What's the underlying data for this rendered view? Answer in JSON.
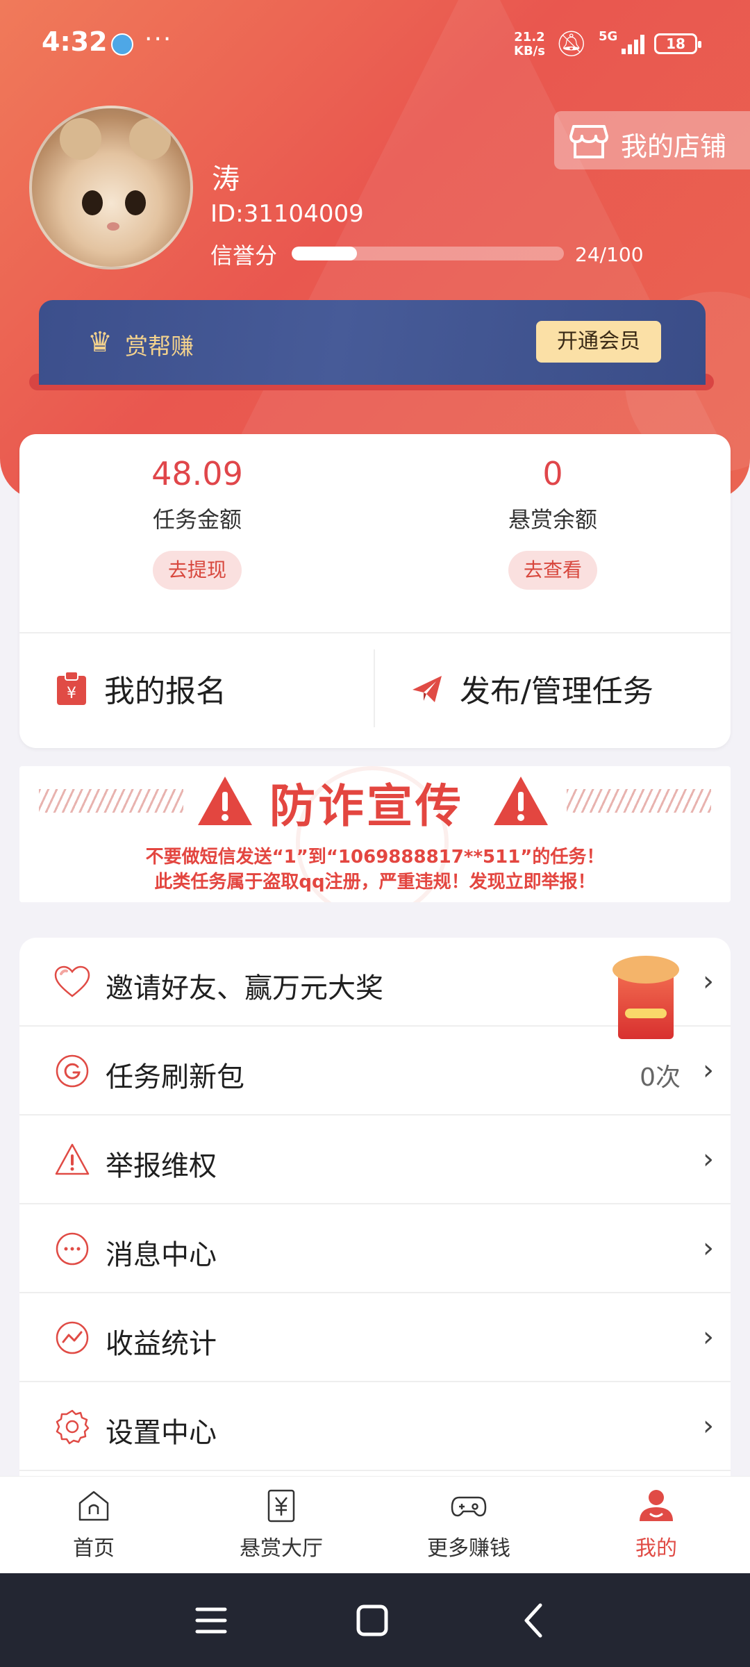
{
  "status_bar": {
    "time": "4:32",
    "dots": "···",
    "speed_value": "21.2",
    "speed_unit": "KB/s",
    "network": "5G",
    "battery": "18"
  },
  "profile": {
    "name": "涛",
    "id": "ID:31104009",
    "credit_label": "信誉分",
    "credit_value": "24/100",
    "credit_fraction": 0.24
  },
  "shop_button": {
    "label": "我的店铺"
  },
  "vip_banner": {
    "name": "赏帮赚",
    "button": "开通会员"
  },
  "balances": [
    {
      "amount": "48.09",
      "label": "任务金额",
      "button": "去提现"
    },
    {
      "amount": "0",
      "label": "悬赏余额",
      "button": "去查看"
    }
  ],
  "actions": {
    "signup": "我的报名",
    "publish": "发布/管理任务"
  },
  "fraud_banner": {
    "title": "防诈宣传",
    "line1": "不要做短信发送“1”到“1069888817**511”的任务！",
    "line2": "此类任务属于盗取qq注册，严重违规！发现立即举报！"
  },
  "menu": [
    {
      "label": "邀请好友、赢万元大奖",
      "icon": "heart-icon"
    },
    {
      "label": "任务刷新包",
      "icon": "refresh-icon",
      "right": "0次"
    },
    {
      "label": "举报维权",
      "icon": "warning-icon"
    },
    {
      "label": "消息中心",
      "icon": "message-icon"
    },
    {
      "label": "收益统计",
      "icon": "chart-icon"
    },
    {
      "label": "设置中心",
      "icon": "gear-icon"
    }
  ],
  "tabs": [
    {
      "label": "首页",
      "icon": "home-icon"
    },
    {
      "label": "悬赏大厅",
      "icon": "yuan-icon"
    },
    {
      "label": "更多赚钱",
      "icon": "gamepad-icon"
    },
    {
      "label": "我的",
      "icon": "user-icon",
      "active": true
    }
  ],
  "colors": {
    "accent": "#e04b45",
    "header": "#e9574f",
    "vip": "#3c4f8c",
    "vip_gold": "#f3d28d"
  }
}
